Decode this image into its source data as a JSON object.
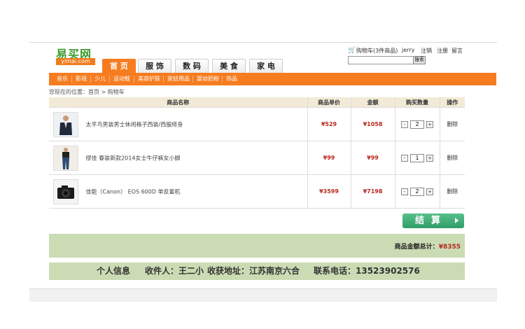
{
  "logo": {
    "cn": "易买网",
    "en": "yimai.com"
  },
  "tabs": [
    {
      "label": "首 页"
    },
    {
      "label": "服 饰"
    },
    {
      "label": "数 码"
    },
    {
      "label": "美 食"
    },
    {
      "label": "家 电"
    }
  ],
  "nav": [
    {
      "label": "音乐"
    },
    {
      "label": "影视"
    },
    {
      "label": "少儿"
    },
    {
      "label": "运动鞋"
    },
    {
      "label": "美容护肤"
    },
    {
      "label": "家纺用品"
    },
    {
      "label": "婴幼奶粉"
    },
    {
      "label": "饰品"
    }
  ],
  "user": {
    "cart": "购物车(3件商品)",
    "username": "jerry",
    "logout": "注销",
    "register": "注册",
    "message": "留言"
  },
  "search": {
    "button": "搜索",
    "value": ""
  },
  "breadcrumb": {
    "prefix": "您现在的位置：",
    "home": "首页",
    "separator": " > ",
    "current": "购物车"
  },
  "table": {
    "headers": {
      "name": "商品名称",
      "price": "商品单价",
      "amount": "金额",
      "qty": "购买数量",
      "action": "操作"
    },
    "rows": [
      {
        "name": "太平鸟男装男士休闲格子西装/西服修身",
        "price": "¥529",
        "amount": "¥1058",
        "qty": "2",
        "delete": "删除"
      },
      {
        "name": "缪佳 春装新款2014女士牛仔裤女小脚",
        "price": "¥99",
        "amount": "¥99",
        "qty": "1",
        "delete": "删除"
      },
      {
        "name": "佳能（Canon） EOS 600D 单反套机",
        "price": "¥3599",
        "amount": "¥7198",
        "qty": "2",
        "delete": "删除"
      }
    ],
    "minus": "-",
    "plus": "+"
  },
  "checkout": {
    "label": "结算"
  },
  "total": {
    "label": "商品金额总计：",
    "value": "¥8355"
  },
  "info": {
    "title": "个人信息",
    "receiver": "收件人：王二小",
    "address": "收获地址：江苏南京六合",
    "phone": "联系电话：13523902576"
  },
  "colors": {
    "orange": "#f67c1f",
    "green_bar": "#cbdcb4",
    "price_red": "#b5281e",
    "checkout_green": "#2f9d67"
  }
}
